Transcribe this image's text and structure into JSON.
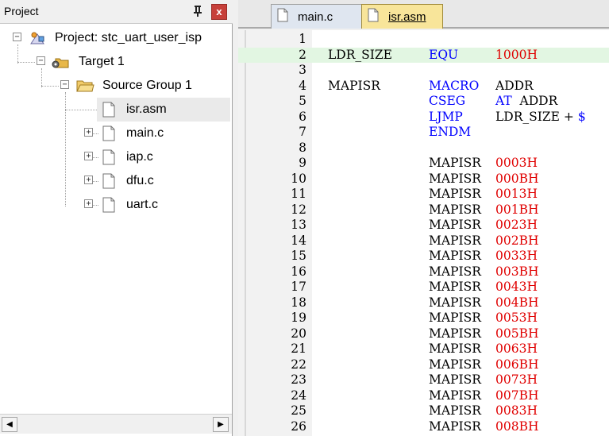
{
  "project_panel": {
    "title": "Project",
    "close_label": "x",
    "tree": [
      {
        "label": "Project: stc_uart_user_isp",
        "expander": "−",
        "icon": "project-icon"
      },
      {
        "label": "Target 1",
        "expander": "−",
        "icon": "target-icon"
      },
      {
        "label": "Source Group 1",
        "expander": "−",
        "icon": "folder-icon"
      },
      {
        "label": "isr.asm",
        "expander": "",
        "icon": "file-icon"
      },
      {
        "label": "main.c",
        "expander": "+",
        "icon": "file-icon"
      },
      {
        "label": "iap.c",
        "expander": "+",
        "icon": "file-icon"
      },
      {
        "label": "dfu.c",
        "expander": "+",
        "icon": "file-icon"
      },
      {
        "label": "uart.c",
        "expander": "+",
        "icon": "file-icon"
      }
    ]
  },
  "tabs": [
    {
      "label": "main.c",
      "active": false
    },
    {
      "label": "isr.asm",
      "active": true
    }
  ],
  "editor": {
    "lines": [
      {
        "n": "1",
        "c1": "",
        "c2": "",
        "c3": ""
      },
      {
        "n": "2",
        "c1": "LDR_SIZE",
        "c2": "EQU",
        "c3": "1000H"
      },
      {
        "n": "3",
        "c1": "",
        "c2": "",
        "c3": ""
      },
      {
        "n": "4",
        "c1": "MAPISR",
        "c2": "MACRO",
        "c3": "ADDR"
      },
      {
        "n": "5",
        "c1": "",
        "c2": "CSEG",
        "c3": "AT  ADDR"
      },
      {
        "n": "6",
        "c1": "",
        "c2": "LJMP",
        "c3": "LDR_SIZE + $"
      },
      {
        "n": "7",
        "c1": "",
        "c2": "ENDM",
        "c3": ""
      },
      {
        "n": "8",
        "c1": "",
        "c2": "",
        "c3": ""
      },
      {
        "n": "9",
        "c1": "",
        "c2": "MAPISR",
        "c3": "0003H"
      },
      {
        "n": "10",
        "c1": "",
        "c2": "MAPISR",
        "c3": "000BH"
      },
      {
        "n": "11",
        "c1": "",
        "c2": "MAPISR",
        "c3": "0013H"
      },
      {
        "n": "12",
        "c1": "",
        "c2": "MAPISR",
        "c3": "001BH"
      },
      {
        "n": "13",
        "c1": "",
        "c2": "MAPISR",
        "c3": "0023H"
      },
      {
        "n": "14",
        "c1": "",
        "c2": "MAPISR",
        "c3": "002BH"
      },
      {
        "n": "15",
        "c1": "",
        "c2": "MAPISR",
        "c3": "0033H"
      },
      {
        "n": "16",
        "c1": "",
        "c2": "MAPISR",
        "c3": "003BH"
      },
      {
        "n": "17",
        "c1": "",
        "c2": "MAPISR",
        "c3": "0043H"
      },
      {
        "n": "18",
        "c1": "",
        "c2": "MAPISR",
        "c3": "004BH"
      },
      {
        "n": "19",
        "c1": "",
        "c2": "MAPISR",
        "c3": "0053H"
      },
      {
        "n": "20",
        "c1": "",
        "c2": "MAPISR",
        "c3": "005BH"
      },
      {
        "n": "21",
        "c1": "",
        "c2": "MAPISR",
        "c3": "0063H"
      },
      {
        "n": "22",
        "c1": "",
        "c2": "MAPISR",
        "c3": "006BH"
      },
      {
        "n": "23",
        "c1": "",
        "c2": "MAPISR",
        "c3": "0073H"
      },
      {
        "n": "24",
        "c1": "",
        "c2": "MAPISR",
        "c3": "007BH"
      },
      {
        "n": "25",
        "c1": "",
        "c2": "MAPISR",
        "c3": "0083H"
      },
      {
        "n": "26",
        "c1": "",
        "c2": "MAPISR",
        "c3": "008BH"
      }
    ]
  },
  "colors": {
    "keyword": "#0000ff",
    "number": "#e00000",
    "current_line": "#e2f6e2",
    "active_tab": "#f8e59a"
  }
}
